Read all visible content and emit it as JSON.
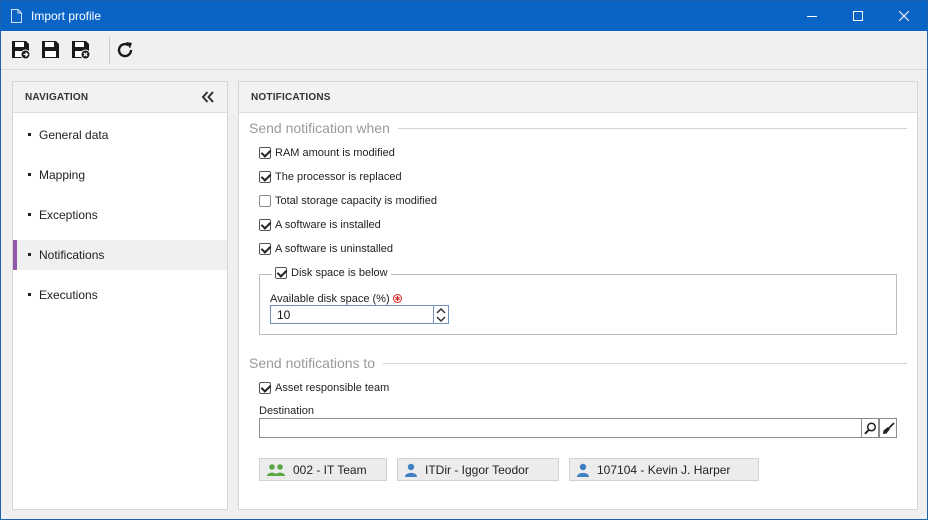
{
  "window": {
    "title": "Import profile",
    "accent_color": "#0a64c6"
  },
  "toolbar": {
    "buttons": [
      "save-and-new-icon",
      "save-icon",
      "save-and-close-icon",
      "refresh-icon"
    ]
  },
  "navigation": {
    "header": "NAVIGATION",
    "items": [
      {
        "label": "General data",
        "active": false
      },
      {
        "label": "Mapping",
        "active": false
      },
      {
        "label": "Exceptions",
        "active": false
      },
      {
        "label": "Notifications",
        "active": true
      },
      {
        "label": "Executions",
        "active": false
      }
    ],
    "active_color": "#8e5aa8"
  },
  "main": {
    "header": "NOTIFICATIONS",
    "send_when": {
      "title": "Send notification when",
      "options": [
        {
          "label": "RAM amount is modified",
          "checked": true
        },
        {
          "label": "The processor is replaced",
          "checked": true
        },
        {
          "label": "Total storage capacity is modified",
          "checked": false
        },
        {
          "label": "A software is installed",
          "checked": true
        },
        {
          "label": "A software is uninstalled",
          "checked": true
        }
      ],
      "disk_space": {
        "legend": "Disk space is below",
        "checked": true,
        "field_label": "Available disk space (%)",
        "value": "10"
      }
    },
    "send_to": {
      "title": "Send notifications to",
      "asset_team": {
        "label": "Asset responsible team",
        "checked": true
      },
      "destination_label": "Destination",
      "destination_value": "",
      "recipients": [
        {
          "label": "002 - IT Team",
          "icon": "group-icon"
        },
        {
          "label": "ITDir - Iggor Teodor",
          "icon": "user-icon"
        },
        {
          "label": "107104 - Kevin J. Harper",
          "icon": "user-icon"
        }
      ]
    }
  }
}
